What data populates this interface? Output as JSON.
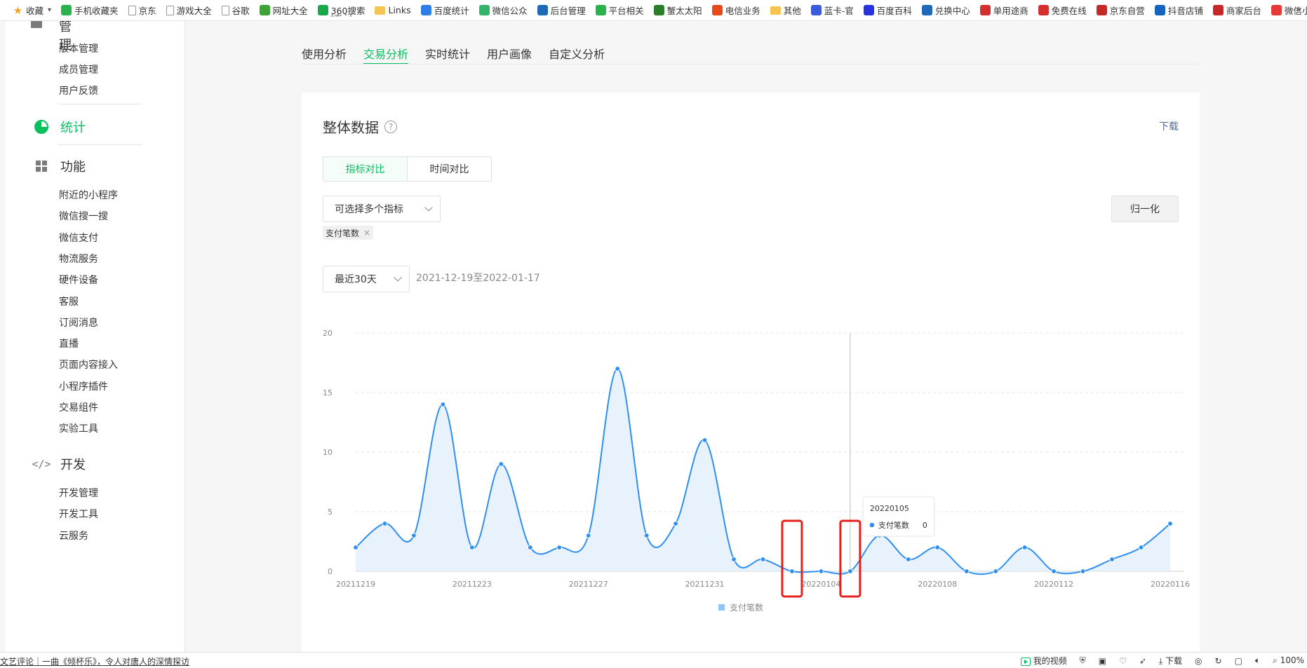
{
  "bookmarks": [
    {
      "label": "收藏",
      "icon": "star-icon",
      "color": "#f2a51a"
    },
    {
      "label": "手机收藏夹",
      "icon": "phone-icon",
      "color": "#2bb24c"
    },
    {
      "label": "京东",
      "icon": "doc-icon",
      "color": "#999999"
    },
    {
      "label": "游戏大全",
      "icon": "doc-icon",
      "color": "#999999"
    },
    {
      "label": "谷歌",
      "icon": "doc-icon",
      "color": "#999999"
    },
    {
      "label": "网址大全",
      "icon": "globe-icon",
      "color": "#3da336"
    },
    {
      "label": "360搜索",
      "icon": "search-360-icon",
      "color": "#19a94b"
    },
    {
      "label": "Links",
      "icon": "folder-icon",
      "color": "#f5c451"
    },
    {
      "label": "百度统计",
      "icon": "baidu-tongji-icon",
      "color": "#2e7fe8"
    },
    {
      "label": "微信公众",
      "icon": "cloud-icon",
      "color": "#34b36b"
    },
    {
      "label": "后台管理",
      "icon": "cloud-icon",
      "color": "#1e6ab8"
    },
    {
      "label": "平台相关",
      "icon": "wechat-icon",
      "color": "#2bb24c"
    },
    {
      "label": "蟹太太阳",
      "icon": "crab-icon",
      "color": "#2a7d2a"
    },
    {
      "label": "电信业务",
      "icon": "telecom-icon",
      "color": "#e64a19"
    },
    {
      "label": "其他",
      "icon": "folder-icon",
      "color": "#f5c451"
    },
    {
      "label": "蓝卡-官",
      "icon": "card-icon",
      "color": "#3b5bdb"
    },
    {
      "label": "百度百科",
      "icon": "baidu-icon",
      "color": "#2932e1"
    },
    {
      "label": "兑换中心",
      "icon": "cloud-icon",
      "color": "#1e6ab8"
    },
    {
      "label": "单用途商",
      "icon": "grid-red-icon",
      "color": "#d32f2f"
    },
    {
      "label": "免费在线",
      "icon": "circle-red-icon",
      "color": "#d32f2f"
    },
    {
      "label": "京东自营",
      "icon": "jd-icon",
      "color": "#c62828"
    },
    {
      "label": "抖音店铺",
      "icon": "douyin-icon",
      "color": "#1565c0"
    },
    {
      "label": "商家后台",
      "icon": "shop-icon",
      "color": "#c62828"
    },
    {
      "label": "微信小程",
      "icon": "app-icon",
      "color": "#e53935"
    }
  ],
  "bookmark_more": "»",
  "page_title_cut": "统计",
  "sidebar": {
    "head": "管理",
    "head_items": [
      "版本管理",
      "成员管理",
      "用户反馈"
    ],
    "stats_label": "统计",
    "func_label": "功能",
    "func_items": [
      "附近的小程序",
      "微信搜一搜",
      "微信支付",
      "物流服务",
      "硬件设备",
      "客服",
      "订阅消息",
      "直播",
      "页面内容接入",
      "小程序插件",
      "交易组件",
      "实验工具"
    ],
    "dev_label": "开发",
    "dev_items": [
      "开发管理",
      "开发工具",
      "云服务"
    ]
  },
  "tabs": [
    "使用分析",
    "交易分析",
    "实时统计",
    "用户画像",
    "自定义分析"
  ],
  "active_tab": "交易分析",
  "card": {
    "title": "整体数据",
    "help": "?",
    "download": "下载",
    "seg_left": "指标对比",
    "seg_right": "时间对比",
    "metric_select": "可选择多个指标",
    "normalize": "归一化",
    "tag": "支付笔数",
    "tag_close": "×",
    "period_select": "最近30天",
    "date_range": "2021-12-19至2022-01-17"
  },
  "tooltip": {
    "date": "20220105",
    "series": "支付笔数",
    "value": "0"
  },
  "chart_data": {
    "type": "area",
    "x": [
      "20211219",
      "20211220",
      "20211221",
      "20211222",
      "20211223",
      "20211224",
      "20211225",
      "20211226",
      "20211227",
      "20211228",
      "20211229",
      "20211230",
      "20211231",
      "20220101",
      "20220102",
      "20220103",
      "20220104",
      "20220105",
      "20220106",
      "20220107",
      "20220108",
      "20220109",
      "20220110",
      "20220111",
      "20220112",
      "20220113",
      "20220114",
      "20220115",
      "20220116"
    ],
    "x_ticks": [
      "20211219",
      "20211223",
      "20211227",
      "20211231",
      "20220104",
      "20220108",
      "20220112",
      "20220116"
    ],
    "series": [
      {
        "name": "支付笔数",
        "color": "#2f8ff0",
        "values": [
          2,
          4,
          3,
          14,
          2,
          9,
          2,
          2,
          3,
          17,
          3,
          4,
          11,
          1,
          1,
          0,
          0,
          0,
          3,
          1,
          2,
          0,
          0,
          2,
          0,
          0,
          1,
          2,
          4
        ]
      }
    ],
    "yticks": [
      0,
      5,
      10,
      15,
      20
    ],
    "ylim": [
      0,
      20
    ],
    "grid": true,
    "legend": "bottom",
    "highlight_boxes": [
      "20220103",
      "20220105"
    ],
    "highlight_color": "#e8201b"
  },
  "statusbar": {
    "news": "文艺评论｜一曲《倾杯乐》，令人对唐人的深情探访",
    "my_video": "我的视频",
    "download": "下载",
    "zoom": "100%"
  }
}
